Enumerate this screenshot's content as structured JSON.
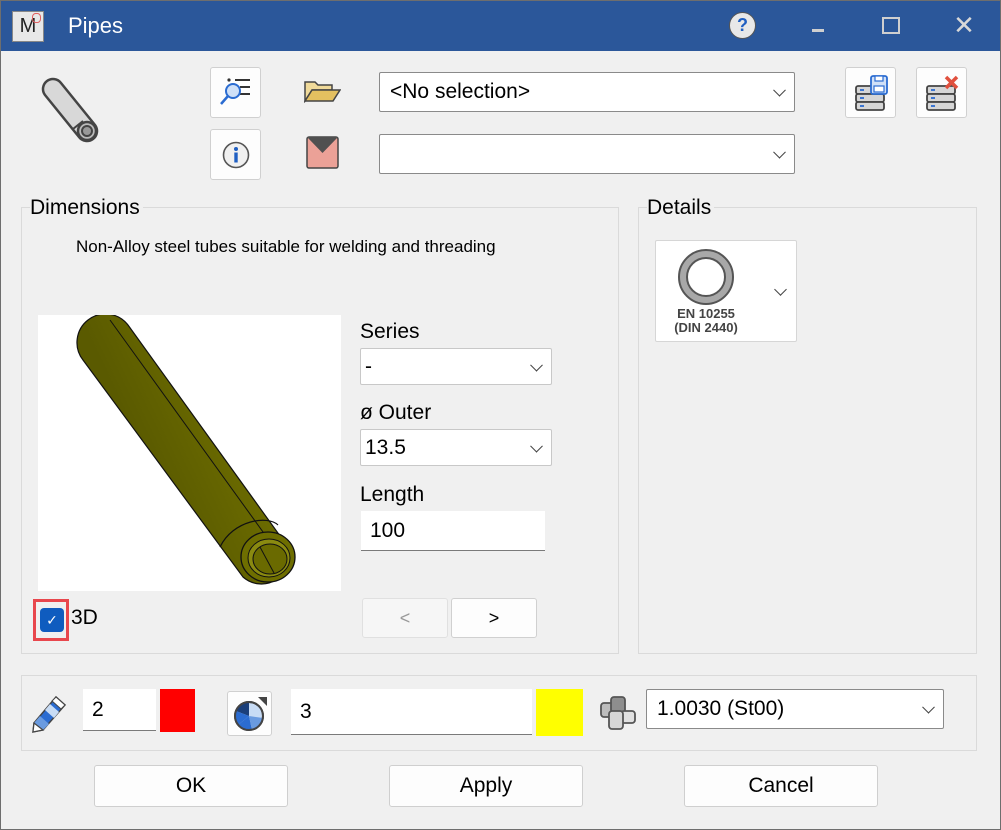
{
  "window": {
    "title": "Pipes",
    "app_icon_letter": "M",
    "controls": [
      "help",
      "minimize",
      "maximize",
      "close"
    ],
    "help_glyph": "?",
    "close_glyph": "✕"
  },
  "toolbar": {
    "library_combo": {
      "value": "<No selection>"
    },
    "layer_combo": {
      "value": ""
    },
    "icons": [
      "pipe-icon",
      "search-list-icon",
      "info-icon",
      "folder-open-icon",
      "layer-color-icon",
      "database-save-icon",
      "database-delete-icon"
    ]
  },
  "dimensions": {
    "label": "Dimensions",
    "description": "Non-Alloy steel tubes suitable for welding and threading",
    "series": {
      "label": "Series",
      "value": "-"
    },
    "outer": {
      "label": "ø Outer",
      "value": "13.5"
    },
    "length": {
      "label": "Length",
      "value": "100"
    },
    "prev_label": "<",
    "next_label": ">",
    "checkbox_3d": {
      "label": "3D",
      "checked": true,
      "check_glyph": "✓"
    },
    "preview_color": "#6e6e00"
  },
  "details": {
    "label": "Details",
    "standard_line1": "EN 10255",
    "standard_line2": "(DIN 2440)"
  },
  "properties": {
    "pen_width": "2",
    "pen_color": "#ff0000",
    "fill_value": "3",
    "fill_color": "#ffff00",
    "material": "1.0030 (St00)"
  },
  "buttons": {
    "ok": "OK",
    "apply": "Apply",
    "cancel": "Cancel"
  }
}
